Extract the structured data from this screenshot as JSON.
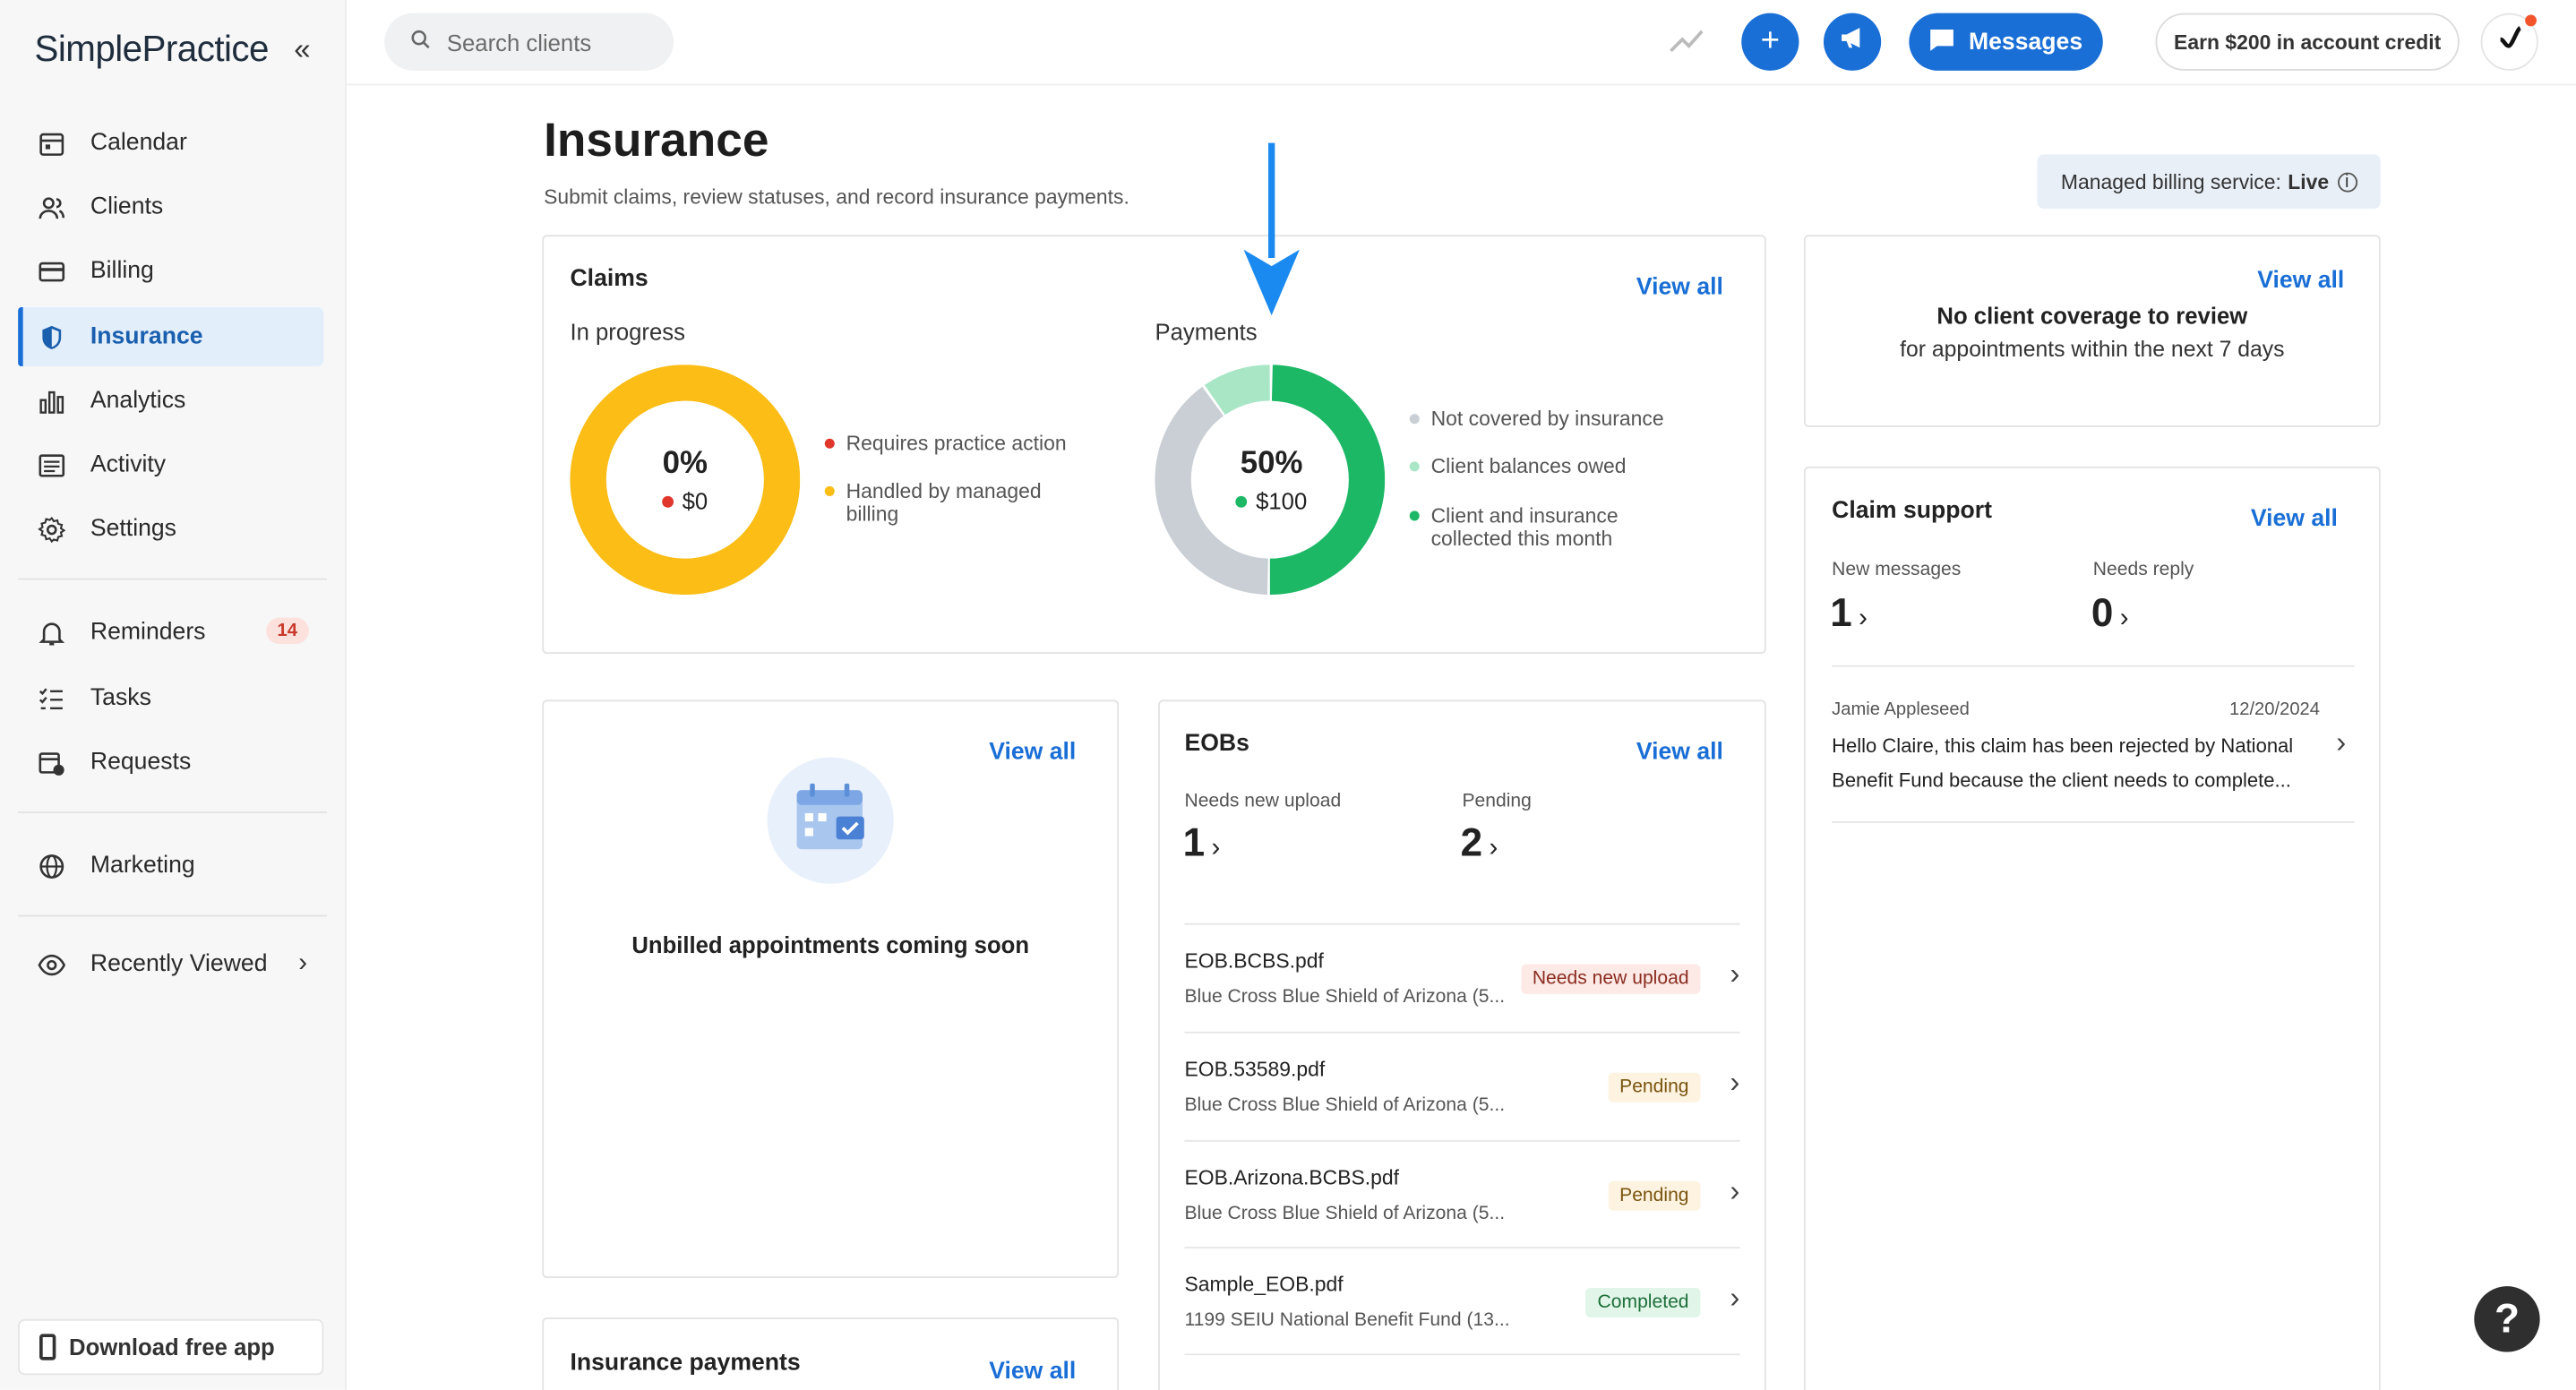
{
  "app": {
    "brand": "SimplePractice"
  },
  "sidebar": {
    "items": [
      {
        "label": "Calendar",
        "icon": "calendar-icon"
      },
      {
        "label": "Clients",
        "icon": "clients-icon"
      },
      {
        "label": "Billing",
        "icon": "billing-card-icon"
      },
      {
        "label": "Insurance",
        "icon": "shield-icon",
        "active": true
      },
      {
        "label": "Analytics",
        "icon": "bar-chart-icon"
      },
      {
        "label": "Activity",
        "icon": "activity-list-icon"
      },
      {
        "label": "Settings",
        "icon": "gear-icon"
      }
    ],
    "items2": [
      {
        "label": "Reminders",
        "icon": "bell-icon",
        "badge": "14"
      },
      {
        "label": "Tasks",
        "icon": "checklist-icon"
      },
      {
        "label": "Requests",
        "icon": "calendar-request-icon"
      }
    ],
    "marketing": {
      "label": "Marketing",
      "icon": "globe-icon"
    },
    "recently_viewed": {
      "label": "Recently Viewed",
      "icon": "eye-icon"
    },
    "download_app": "Download free app"
  },
  "topbar": {
    "search_placeholder": "Search clients",
    "messages_label": "Messages",
    "earn_label": "Earn $200 in account credit"
  },
  "page": {
    "title": "Insurance",
    "subtitle": "Submit claims, review statuses, and record insurance payments.",
    "managed_label": "Managed billing service:",
    "managed_status": "Live"
  },
  "claims": {
    "title": "Claims",
    "view_all": "View all",
    "in_progress": {
      "label": "In progress",
      "pct": "0%",
      "amount": "$0",
      "legend": [
        {
          "label": "Requires practice action",
          "color": "#e0362b"
        },
        {
          "label": "Handled by managed billing",
          "color": "#fbbd16"
        }
      ]
    },
    "payments": {
      "label": "Payments",
      "pct": "50%",
      "amount": "$100",
      "legend": [
        {
          "label": "Not covered by insurance",
          "color": "#c9cfd4"
        },
        {
          "label": "Client balances owed",
          "color": "#a8e6c6"
        },
        {
          "label": "Client and insurance collected this month",
          "color": "#1db866"
        }
      ],
      "shares": {
        "collected": 0.5,
        "balances": 0.1,
        "not_covered": 0.4
      }
    }
  },
  "coverage": {
    "view_all": "View all",
    "title": "No client coverage to review",
    "subtitle": "for appointments within the next 7 days"
  },
  "claim_support": {
    "title": "Claim support",
    "view_all": "View all",
    "new_messages_label": "New messages",
    "new_messages": "1",
    "needs_reply_label": "Needs reply",
    "needs_reply": "0",
    "message": {
      "sender": "Jamie Appleseed",
      "date": "12/20/2024",
      "text": "Hello Claire, this claim has been rejected by National Benefit Fund because the client needs to complete..."
    }
  },
  "unbilled": {
    "view_all": "View all",
    "text": "Unbilled appointments coming soon"
  },
  "eobs": {
    "title": "EOBs",
    "view_all": "View all",
    "needs_upload_label": "Needs new upload",
    "needs_upload": "1",
    "pending_label": "Pending",
    "pending": "2",
    "rows": [
      {
        "file": "EOB.BCBS.pdf",
        "payer": "Blue Cross Blue Shield of Arizona (5...",
        "status": "Needs new upload"
      },
      {
        "file": "EOB.53589.pdf",
        "payer": "Blue Cross Blue Shield of Arizona (5...",
        "status": "Pending"
      },
      {
        "file": "EOB.Arizona.BCBS.pdf",
        "payer": "Blue Cross Blue Shield of Arizona (5...",
        "status": "Pending"
      },
      {
        "file": "Sample_EOB.pdf",
        "payer": "1199 SEIU National Benefit Fund (13...",
        "status": "Completed"
      }
    ]
  },
  "insurance_payments": {
    "title": "Insurance payments",
    "view_all": "View all"
  },
  "help": "?",
  "colors": {
    "accent": "#1a6fd6",
    "amber": "#fbbd16",
    "green": "#1db866",
    "light_green": "#a8e6c6",
    "gray": "#c9cfd4",
    "red": "#e0362b"
  }
}
